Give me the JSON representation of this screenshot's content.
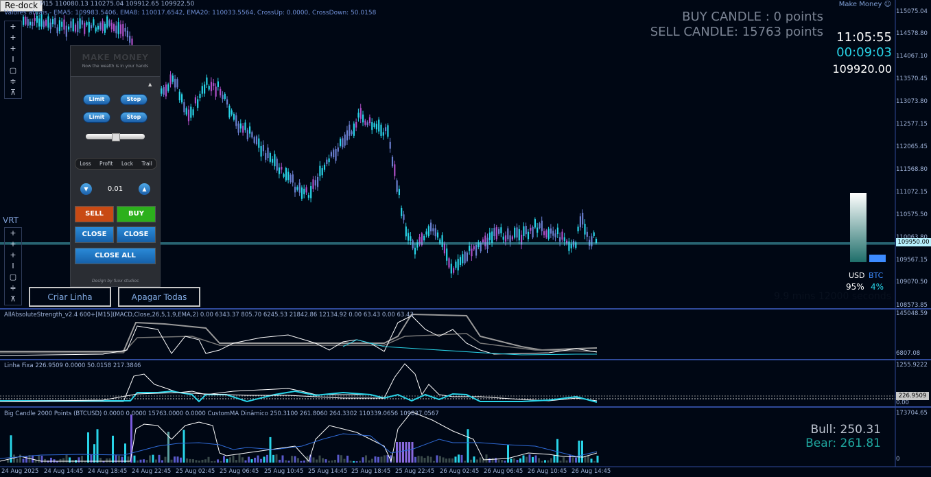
{
  "window": {
    "redock_label": "Re-dock",
    "top_right_label": "Make Money ☺"
  },
  "header": {
    "symbol_line": "M15  110080.13 110275.04 109912.65 109922.50",
    "ema_line": "Valores atuais - EMA5: 109983.5406, EMA8: 110017.6542, EMA20: 110033.5564, CrossUp: 0.0000, CrossDown: 50.0158"
  },
  "toolbar": {
    "tools_top": [
      "+",
      "+",
      "+",
      "I",
      "▢",
      "≑",
      "⊼"
    ],
    "vrt_label": "VRT",
    "tools_bottom": [
      "+",
      "+",
      "+",
      "I",
      "▢",
      "≑",
      "⊼"
    ]
  },
  "candle_stats": {
    "buy_text": "BUY CANDLE : 0 points",
    "sell_text": "SELL CANDLE: 15763 points"
  },
  "clock": {
    "time": "11:05:55",
    "timer": "00:09:03",
    "last_price": "109920.00"
  },
  "trade_panel": {
    "title": "MAKE MONEY",
    "subtitle": "Now the wealth is in your hands",
    "limit_label": "Limit",
    "stop_label": "Stop",
    "tabs": [
      "Loss",
      "Profit",
      "Lock",
      "Trail"
    ],
    "lot_value": "0.01",
    "sell_label": "SELL",
    "buy_label": "BUY",
    "close_label": "CLOSE",
    "close_all_label": "CLOSE ALL",
    "footer": "Design by fuxx studios"
  },
  "buttons": {
    "criar_linha": "Criar Linha",
    "apagar_todas": "Apagar Todas"
  },
  "price_axis": [
    "115075.04",
    "114578.80",
    "114067.10",
    "113570.45",
    "113073.80",
    "112577.15",
    "112065.45",
    "111568.80",
    "111072.15",
    "110575.50",
    "110063.80",
    "109567.15",
    "109070.50",
    "108573.85"
  ],
  "price_tag": "109950.00",
  "strength_bar": {
    "usd_label": "USD",
    "btc_label": "BTC",
    "usd_pct": "95%",
    "btc_pct": "4%",
    "colors": {
      "usd": "#9fd8d0",
      "btc": "#3d8bff"
    }
  },
  "indicators": {
    "ind1_label": "AllAbsoluteStrength_v2.4 600+[M15](MACD,Close,26,5,1,9,EMA,2) 0.00 6343.37 805.70 6245.53 21842.86 12134.92 0.00 63.43 0.00 63.43",
    "ind1_axis": [
      "145048.59",
      "6807.08"
    ],
    "ind2_label": "Linha Fixa 226.9509 0.0000 50.0158 217.3846",
    "ind2_axis": [
      "1255.9222",
      "0.00"
    ],
    "ind2_tag": "226.9509",
    "ind3_label": "Big Candle 2000 Points (BTCUSD) 0.0000 0.0000 15763.0000 0.0000   CustomMA Dinâmico 250.3100 261.8060 264.3302 110339.0656  109837.0567",
    "ind3_axis": [
      "173704.65",
      "0"
    ],
    "bull": "Bull: 250.31",
    "bear": "Bear: 261.81"
  },
  "time_axis": [
    "24 Aug 2025",
    "24 Aug 14:45",
    "24 Aug 18:45",
    "24 Aug 22:45",
    "25 Aug 02:45",
    "25 Aug 06:45",
    "25 Aug 10:45",
    "25 Aug 14:45",
    "25 Aug 18:45",
    "25 Aug 22:45",
    "26 Aug 02:45",
    "26 Aug 06:45",
    "26 Aug 10:45",
    "26 Aug 14:45"
  ],
  "colors": {
    "bg": "#000714",
    "bull_candle": "#28d4e8",
    "bear_candle": "#b050c8",
    "neutral_candle": "#6a7fd0",
    "price_line": "#5ad8e8"
  },
  "ghost_text": "9.9 mins 12000 seconds"
}
